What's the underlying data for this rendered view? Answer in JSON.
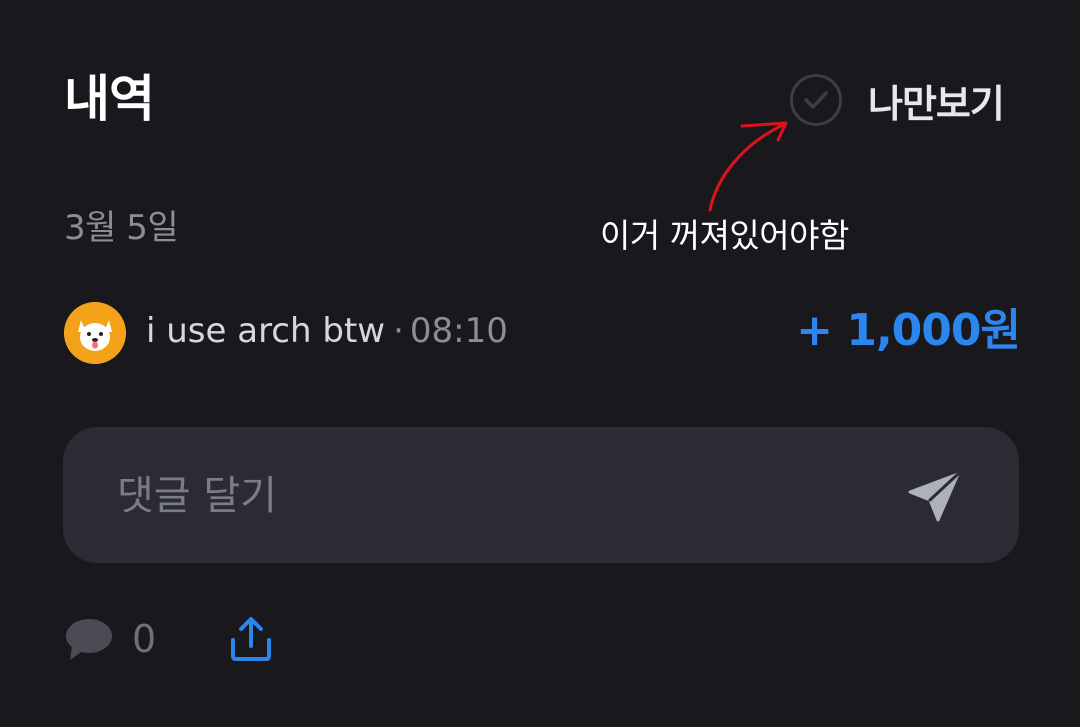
{
  "header": {
    "title": "내역",
    "private_label": "나만보기",
    "private_checked": false
  },
  "annotation": {
    "text": "이거 꺼져있어야함",
    "color": "#e0121b"
  },
  "date": "3월 5일",
  "transaction": {
    "name": "i use arch btw",
    "separator": "·",
    "time": "08:10",
    "amount": "+ 1,000원",
    "amount_color": "#2b86f0",
    "avatar_icon": "dog-avatar-icon",
    "avatar_color": "#f4a21a"
  },
  "comment": {
    "placeholder": "댓글 달기",
    "value": ""
  },
  "footer": {
    "comment_count": "0",
    "share_color": "#2b86f0"
  }
}
